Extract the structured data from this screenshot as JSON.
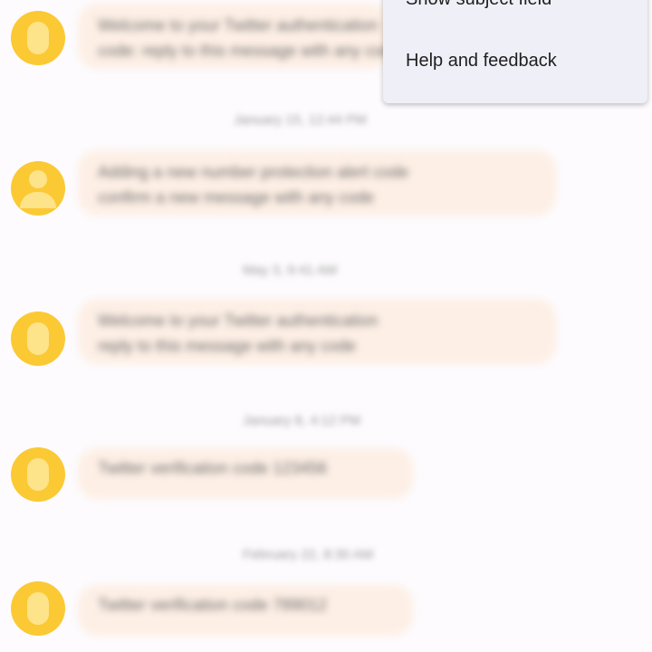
{
  "conversation": {
    "messages": [
      {
        "text_lines": [
          "Welcome to your Twitter authentication",
          "code: reply to this message with any code"
        ]
      },
      {
        "text_lines": [
          "Adding a new number protection alert code",
          "confirm a new message with any code"
        ]
      },
      {
        "text_lines": [
          "Welcome to your Twitter authentication",
          "reply to this message with any code"
        ]
      },
      {
        "text_lines": [
          "Twitter verification code 123456"
        ]
      },
      {
        "text_lines": [
          "Twitter verification code 789012"
        ]
      }
    ],
    "timestamps": [
      "January 15, 12:44 PM",
      "May 3, 9:41 AM",
      "January 8, 4:12 PM",
      "February 22, 8:30 AM"
    ]
  },
  "menu": {
    "items": [
      {
        "label": "Show subject field"
      },
      {
        "label": "Help and feedback"
      }
    ]
  },
  "colors": {
    "background": "#fdfbfd",
    "bubble": "#fdefe5",
    "avatar": "#fbc934",
    "menu": "#efeff7"
  }
}
